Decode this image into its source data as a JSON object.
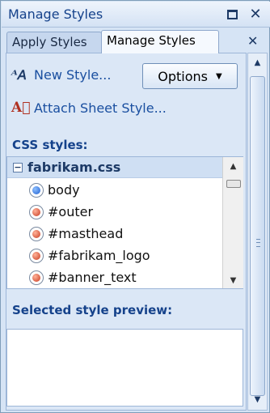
{
  "window": {
    "title": "Manage Styles"
  },
  "tabs": [
    {
      "label": "Apply Styles"
    },
    {
      "label": "Manage Styles"
    }
  ],
  "toolbar": {
    "new_style": "New Style...",
    "attach": "Attach Sheet Style...",
    "options": "Options"
  },
  "css_section": {
    "label": "CSS styles:",
    "file": "fabrikam.css",
    "items": [
      {
        "name": "body",
        "kind": "element"
      },
      {
        "name": "#outer",
        "kind": "id"
      },
      {
        "name": "#masthead",
        "kind": "id"
      },
      {
        "name": "#fabrikam_logo",
        "kind": "id"
      },
      {
        "name": "#banner_text",
        "kind": "id"
      }
    ]
  },
  "preview_section": {
    "label": "Selected style preview:"
  },
  "colors": {
    "accent": "#15428b",
    "panel_bg": "#d6e4f5"
  },
  "icons": {
    "new_style": "new-style-icon",
    "attach": "attach-style-sheet-icon"
  }
}
